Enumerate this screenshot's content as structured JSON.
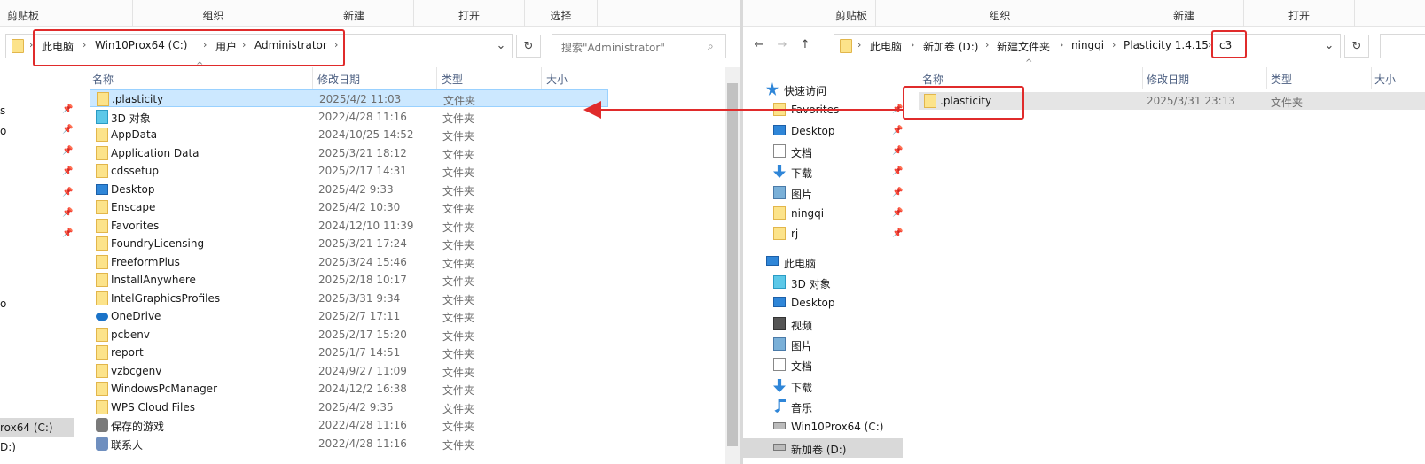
{
  "left": {
    "ribbon": [
      "剪贴板",
      "组织",
      "新建",
      "打开",
      "选择"
    ],
    "path": [
      "此电脑",
      "Win10Prox64 (C:)",
      "用户",
      "Administrator"
    ],
    "search_placeholder": "搜索\"Administrator\"",
    "columns": {
      "name": "名称",
      "date": "修改日期",
      "type": "类型",
      "size": "大小"
    },
    "files": [
      {
        "name": ".plasticity",
        "date": "2025/4/2 11:03",
        "type": "文件夹",
        "icon": "folder-icon"
      },
      {
        "name": "3D 对象",
        "date": "2022/4/28 11:16",
        "type": "文件夹",
        "icon": "3d-objects-icon"
      },
      {
        "name": "AppData",
        "date": "2024/10/25 14:52",
        "type": "文件夹",
        "icon": "folder-icon"
      },
      {
        "name": "Application Data",
        "date": "2025/3/21 18:12",
        "type": "文件夹",
        "icon": "folder-icon"
      },
      {
        "name": "cdssetup",
        "date": "2025/2/17 14:31",
        "type": "文件夹",
        "icon": "folder-icon"
      },
      {
        "name": "Desktop",
        "date": "2025/4/2 9:33",
        "type": "文件夹",
        "icon": "desktop-icon"
      },
      {
        "name": "Enscape",
        "date": "2025/4/2 10:30",
        "type": "文件夹",
        "icon": "folder-icon"
      },
      {
        "name": "Favorites",
        "date": "2024/12/10 11:39",
        "type": "文件夹",
        "icon": "folder-icon"
      },
      {
        "name": "FoundryLicensing",
        "date": "2025/3/21 17:24",
        "type": "文件夹",
        "icon": "folder-icon"
      },
      {
        "name": "FreeformPlus",
        "date": "2025/3/24 15:46",
        "type": "文件夹",
        "icon": "folder-icon"
      },
      {
        "name": "InstallAnywhere",
        "date": "2025/2/18 10:17",
        "type": "文件夹",
        "icon": "folder-icon"
      },
      {
        "name": "IntelGraphicsProfiles",
        "date": "2025/3/31 9:34",
        "type": "文件夹",
        "icon": "folder-icon"
      },
      {
        "name": "OneDrive",
        "date": "2025/2/7 17:11",
        "type": "文件夹",
        "icon": "onedrive-icon"
      },
      {
        "name": "pcbenv",
        "date": "2025/2/17 15:20",
        "type": "文件夹",
        "icon": "folder-icon"
      },
      {
        "name": "report",
        "date": "2025/1/7 14:51",
        "type": "文件夹",
        "icon": "folder-icon"
      },
      {
        "name": "vzbcgenv",
        "date": "2024/9/27 11:09",
        "type": "文件夹",
        "icon": "folder-icon"
      },
      {
        "name": "WindowsPcManager",
        "date": "2024/12/2 16:38",
        "type": "文件夹",
        "icon": "folder-icon"
      },
      {
        "name": "WPS Cloud Files",
        "date": "2025/4/2 9:35",
        "type": "文件夹",
        "icon": "folder-icon"
      },
      {
        "name": "保存的游戏",
        "date": "2022/4/28 11:16",
        "type": "文件夹",
        "icon": "saved-games-icon"
      },
      {
        "name": "联系人",
        "date": "2022/4/28 11:16",
        "type": "文件夹",
        "icon": "contacts-icon"
      }
    ],
    "nav_partial": [
      "s",
      "o",
      "o",
      "rox64 (C:)",
      "D:)"
    ]
  },
  "right": {
    "ribbon": [
      "剪贴板",
      "组织",
      "新建",
      "打开"
    ],
    "path": [
      "此电脑",
      "新加卷 (D:)",
      "新建文件夹",
      "ningqi",
      "Plasticity 1.4.15",
      "c3"
    ],
    "columns": {
      "name": "名称",
      "date": "修改日期",
      "type": "类型",
      "size": "大小"
    },
    "files": [
      {
        "name": ".plasticity",
        "date": "2025/3/31 23:13",
        "type": "文件夹"
      }
    ],
    "nav": [
      {
        "label": "快速访问",
        "icon": "star-icon",
        "pinned": false
      },
      {
        "label": "Favorites",
        "icon": "folder-icon",
        "pinned": true
      },
      {
        "label": "Desktop",
        "icon": "desktop-icon",
        "pinned": true
      },
      {
        "label": "文档",
        "icon": "documents-icon",
        "pinned": true
      },
      {
        "label": "下载",
        "icon": "download-icon",
        "pinned": true
      },
      {
        "label": "图片",
        "icon": "pictures-icon",
        "pinned": true
      },
      {
        "label": "ningqi",
        "icon": "folder-icon",
        "pinned": true
      },
      {
        "label": "rj",
        "icon": "folder-icon",
        "pinned": true
      },
      {
        "label": "此电脑",
        "icon": "this-pc-icon",
        "pinned": false
      },
      {
        "label": "3D 对象",
        "icon": "3d-objects-icon",
        "pinned": false
      },
      {
        "label": "Desktop",
        "icon": "desktop-icon",
        "pinned": false
      },
      {
        "label": "视频",
        "icon": "videos-icon",
        "pinned": false
      },
      {
        "label": "图片",
        "icon": "pictures-icon",
        "pinned": false
      },
      {
        "label": "文档",
        "icon": "documents-icon",
        "pinned": false
      },
      {
        "label": "下载",
        "icon": "download-icon",
        "pinned": false
      },
      {
        "label": "音乐",
        "icon": "music-icon",
        "pinned": false
      },
      {
        "label": "Win10Prox64 (C:)",
        "icon": "drive-icon",
        "pinned": false
      },
      {
        "label": "新加卷 (D:)",
        "icon": "drive-icon",
        "pinned": false
      }
    ]
  },
  "colors": {
    "selection": "#cce8ff",
    "highlight": "#e02b2b",
    "folder": "#fce38a"
  }
}
